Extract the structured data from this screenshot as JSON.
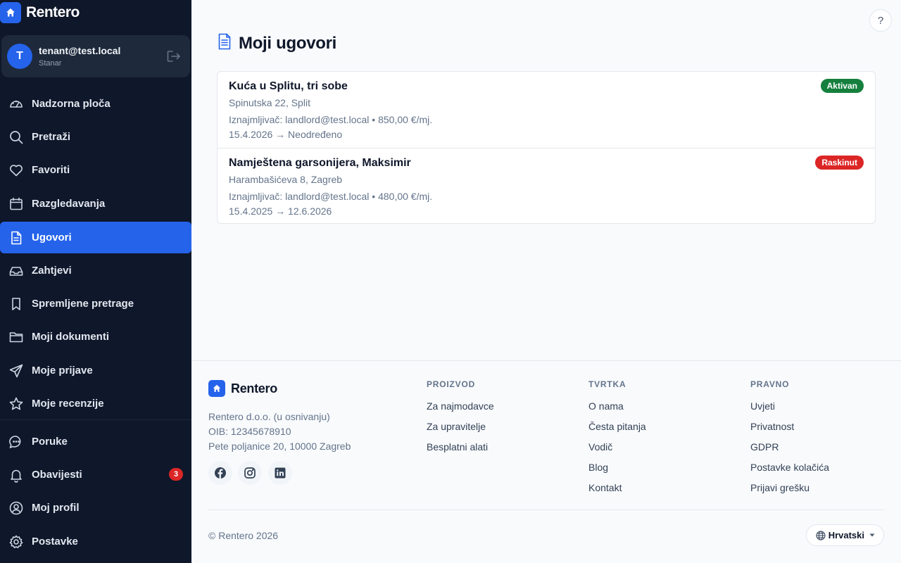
{
  "app": {
    "name": "Rentero"
  },
  "user": {
    "initial": "T",
    "email": "tenant@test.local",
    "role": "Stanar"
  },
  "nav": {
    "items": [
      {
        "label": "Nadzorna ploča"
      },
      {
        "label": "Pretraži"
      },
      {
        "label": "Favoriti"
      },
      {
        "label": "Razgledavanja"
      },
      {
        "label": "Ugovori"
      },
      {
        "label": "Zahtjevi"
      },
      {
        "label": "Spremljene pretrage"
      },
      {
        "label": "Moji dokumenti"
      },
      {
        "label": "Moje prijave"
      },
      {
        "label": "Moje recenzije"
      },
      {
        "label": "Poruke"
      },
      {
        "label": "Obavijesti",
        "badge": "3"
      },
      {
        "label": "Moj profil"
      },
      {
        "label": "Postavke"
      }
    ],
    "active": "Ugovori"
  },
  "header": {
    "help_label": "?"
  },
  "page": {
    "title": "Moji ugovori"
  },
  "contracts": [
    {
      "title": "Kuća u Splitu, tri sobe",
      "address": "Spinutska 22, Split",
      "meta": "Iznajmljivač: landlord@test.local • 850,00 €/mj.",
      "dates": "15.4.2026 → Neodređeno",
      "status": "Aktivan",
      "status_color": "#15803d"
    },
    {
      "title": "Namještena garsonijera, Maksimir",
      "address": "Harambašićeva 8, Zagreb",
      "meta": "Iznajmljivač: landlord@test.local • 480,00 €/mj.",
      "dates": "15.4.2025 → 12.6.2026",
      "status": "Raskinut",
      "status_color": "#dc2626"
    }
  ],
  "footer": {
    "brand": "Rentero",
    "company": [
      "Rentero d.o.o. (u osnivanju)",
      "OIB: 12345678910",
      "Pete poljanice 20, 10000 Zagreb"
    ],
    "columns": [
      {
        "title": "PROIZVOD",
        "links": [
          "Za najmodavce",
          "Za upravitelje",
          "Besplatni alati"
        ]
      },
      {
        "title": "TVRTKA",
        "links": [
          "O nama",
          "Česta pitanja",
          "Vodič",
          "Blog",
          "Kontakt"
        ]
      },
      {
        "title": "PRAVNO",
        "links": [
          "Uvjeti",
          "Privatnost",
          "GDPR",
          "Postavke kolačića",
          "Prijavi grešku"
        ]
      }
    ],
    "copyright": "© Rentero 2026",
    "language": "Hrvatski"
  },
  "colors": {
    "sidebar_bg": "#0f172a",
    "accent": "#2563eb",
    "active_status": "#15803d",
    "terminated_status": "#dc2626"
  }
}
